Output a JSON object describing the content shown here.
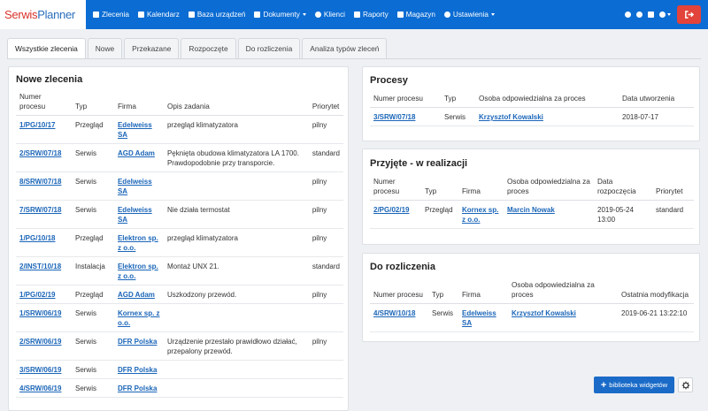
{
  "app": {
    "logo_part1": "Serwis",
    "logo_part2": "Planner"
  },
  "nav": [
    {
      "label": "Zlecenia",
      "icon": "grid-icon",
      "dropdown": false
    },
    {
      "label": "Kalendarz",
      "icon": "calendar-icon",
      "dropdown": false
    },
    {
      "label": "Baza urządzeń",
      "icon": "devices-icon",
      "dropdown": false
    },
    {
      "label": "Dokumenty",
      "icon": "document-icon",
      "dropdown": true
    },
    {
      "label": "Klienci",
      "icon": "user-icon",
      "dropdown": false
    },
    {
      "label": "Raporty",
      "icon": "bar-chart-icon",
      "dropdown": false
    },
    {
      "label": "Magazyn",
      "icon": "warehouse-icon",
      "dropdown": false
    },
    {
      "label": "Ustawienia",
      "icon": "gear-icon",
      "dropdown": true
    }
  ],
  "tabs": [
    "Wszystkie zlecenia",
    "Nowe",
    "Przekazane",
    "Rozpoczęte",
    "Do rozliczenia",
    "Analiza typów zleceń"
  ],
  "left": {
    "title": "Nowe zlecenia",
    "headers": [
      "Numer procesu",
      "Typ",
      "Firma",
      "Opis zadania",
      "Priorytet"
    ],
    "rows": [
      {
        "num": "1/PG/10/17",
        "typ": "Przegląd",
        "firma": "Edelweiss SA",
        "opis": "przegląd klimatyzatora",
        "prio": "pilny"
      },
      {
        "num": "2/SRW/07/18",
        "typ": "Serwis",
        "firma": "AGD Adam",
        "opis": "Pęknięta obudowa klimatyzatora LA 1700. Prawdopodobnie przy transporcie.",
        "prio": "standard"
      },
      {
        "num": "8/SRW/07/18",
        "typ": "Serwis",
        "firma": "Edelweiss SA",
        "opis": "",
        "prio": "pilny"
      },
      {
        "num": "7/SRW/07/18",
        "typ": "Serwis",
        "firma": "Edelweiss SA",
        "opis": "Nie działa termostat",
        "prio": "pilny"
      },
      {
        "num": "1/PG/10/18",
        "typ": "Przegląd",
        "firma": "Elektron sp. z o.o.",
        "opis": "przegląd klimatyzatora",
        "prio": "pilny"
      },
      {
        "num": "2/INST/10/18",
        "typ": "Instalacja",
        "firma": "Elektron sp. z o.o.",
        "opis": "Montaż UNX 21.",
        "prio": "standard"
      },
      {
        "num": "1/PG/02/19",
        "typ": "Przegląd",
        "firma": "AGD Adam",
        "opis": "Uszkodzony przewód.",
        "prio": "pilny"
      },
      {
        "num": "1/SRW/06/19",
        "typ": "Serwis",
        "firma": "Kornex sp. z o.o.",
        "opis": "",
        "prio": ""
      },
      {
        "num": "2/SRW/06/19",
        "typ": "Serwis",
        "firma": "DFR Polska",
        "opis": "Urządzenie przestało prawidłowo działać, przepalony przewód.",
        "prio": "pilny"
      },
      {
        "num": "3/SRW/06/19",
        "typ": "Serwis",
        "firma": "DFR Polska",
        "opis": "",
        "prio": ""
      },
      {
        "num": "4/SRW/06/19",
        "typ": "Serwis",
        "firma": "DFR Polska",
        "opis": "",
        "prio": ""
      }
    ]
  },
  "procesy": {
    "title": "Procesy",
    "headers": [
      "Numer procesu",
      "Typ",
      "Osoba odpowiedzialna za proces",
      "Data utworzenia"
    ],
    "rows": [
      {
        "num": "3/SRW/07/18",
        "typ": "Serwis",
        "osoba": "Krzysztof Kowalski",
        "data": "2018-07-17"
      }
    ]
  },
  "realizacja": {
    "title": "Przyjęte - w realizacji",
    "headers": [
      "Numer procesu",
      "Typ",
      "Firma",
      "Osoba odpowiedzialna za proces",
      "Data rozpoczęcia",
      "Priorytet"
    ],
    "rows": [
      {
        "num": "2/PG/02/19",
        "typ": "Przegląd",
        "firma": "Kornex sp. z o.o.",
        "osoba": "Marcin Nowak",
        "data": "2019-05-24 13:00",
        "prio": "standard"
      }
    ]
  },
  "rozliczenie": {
    "title": "Do rozliczenia",
    "headers": [
      "Numer procesu",
      "Typ",
      "Firma",
      "Osoba odpowiedzialna za proces",
      "Ostatnia modyfikacja"
    ],
    "rows": [
      {
        "num": "4/SRW/10/18",
        "typ": "Serwis",
        "firma": "Edelweiss SA",
        "osoba": "Krzysztof Kowalski",
        "data": "2019-06-21 13:22:10"
      }
    ]
  },
  "widgets": {
    "library_label": "biblioteka widgetów"
  },
  "colors": {
    "brand": "#0b6cd3",
    "logout": "#e2433a",
    "link": "#1a65b8"
  }
}
